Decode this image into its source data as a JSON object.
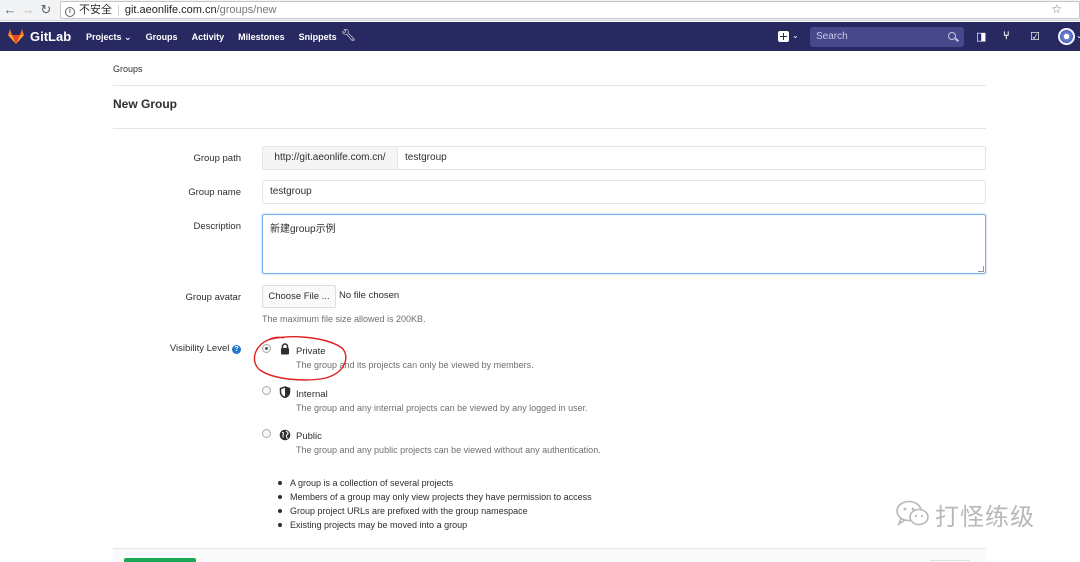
{
  "browser": {
    "security_label": "不安全",
    "url_host": "git.aeonlife.com.cn",
    "url_path": "/groups/new"
  },
  "header": {
    "brand": "GitLab",
    "nav": [
      "Projects ⌄",
      "Groups",
      "Activity",
      "Milestones",
      "Snippets"
    ],
    "search_placeholder": "Search",
    "colors": {
      "header_bg": "#292961",
      "search_bg": "#47478c"
    }
  },
  "breadcrumb": "Groups",
  "page_title": "New Group",
  "form": {
    "group_path_label": "Group path",
    "group_path_prefix": "http://git.aeonlife.com.cn/",
    "group_path_value": "testgroup",
    "group_name_label": "Group name",
    "group_name_value": "testgroup",
    "description_label": "Description",
    "description_value": "新建group示例",
    "avatar_label": "Group avatar",
    "choose_file_label": "Choose File ...",
    "no_file_text": "No file chosen",
    "avatar_help": "The maximum file size allowed is 200KB.",
    "visibility_label": "Visibility Level",
    "visibility_options": [
      {
        "title": "Private",
        "desc": "The group and its projects can only be viewed by members.",
        "icon": "lock-icon",
        "checked": true
      },
      {
        "title": "Internal",
        "desc": "The group and any internal projects can be viewed by any logged in user.",
        "icon": "shield-icon",
        "checked": false
      },
      {
        "title": "Public",
        "desc": "The group and any public projects can be viewed without any authentication.",
        "icon": "globe-icon",
        "checked": false
      }
    ],
    "notes": [
      "A group is a collection of several projects",
      "Members of a group may only view projects they have permission to access",
      "Group project URLs are prefixed with the group namespace",
      "Existing projects may be moved into a group"
    ]
  },
  "watermark": "打怪练级"
}
